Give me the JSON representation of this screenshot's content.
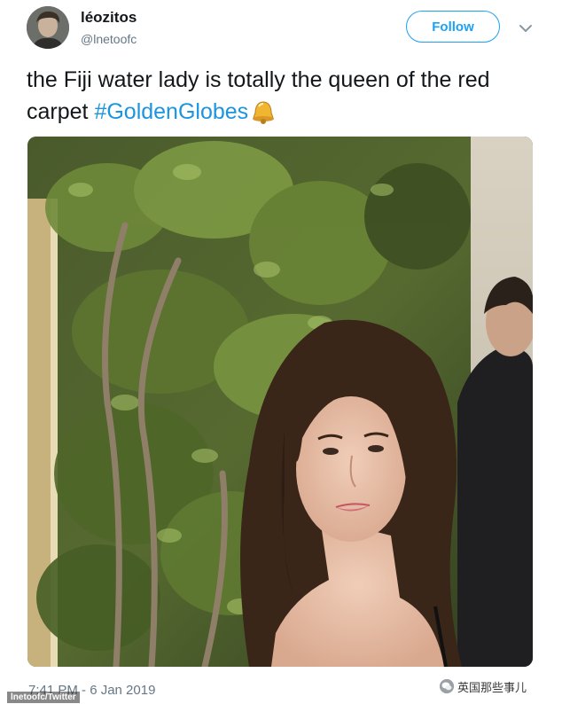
{
  "author": {
    "name": "léozitos",
    "handle": "@lnetoofc"
  },
  "follow_button": {
    "label": "Follow"
  },
  "tweet": {
    "text_before": "the Fiji water lady is totally the queen of the red carpet ",
    "hashtag": "#GoldenGlobes",
    "emoji": "bell-emoji",
    "timestamp": "7:41 PM - 6 Jan 2019"
  },
  "photo": {
    "subject": "woman-on-red-carpet"
  },
  "credit": "lnetoofc/Twitter",
  "watermark": {
    "icon": "wechat-icon",
    "text": "英国那些事儿"
  },
  "colors": {
    "accent": "#1da1f2",
    "hashtag": "#1b95e0",
    "secondary_text": "#657786",
    "primary_text": "#14171a"
  }
}
